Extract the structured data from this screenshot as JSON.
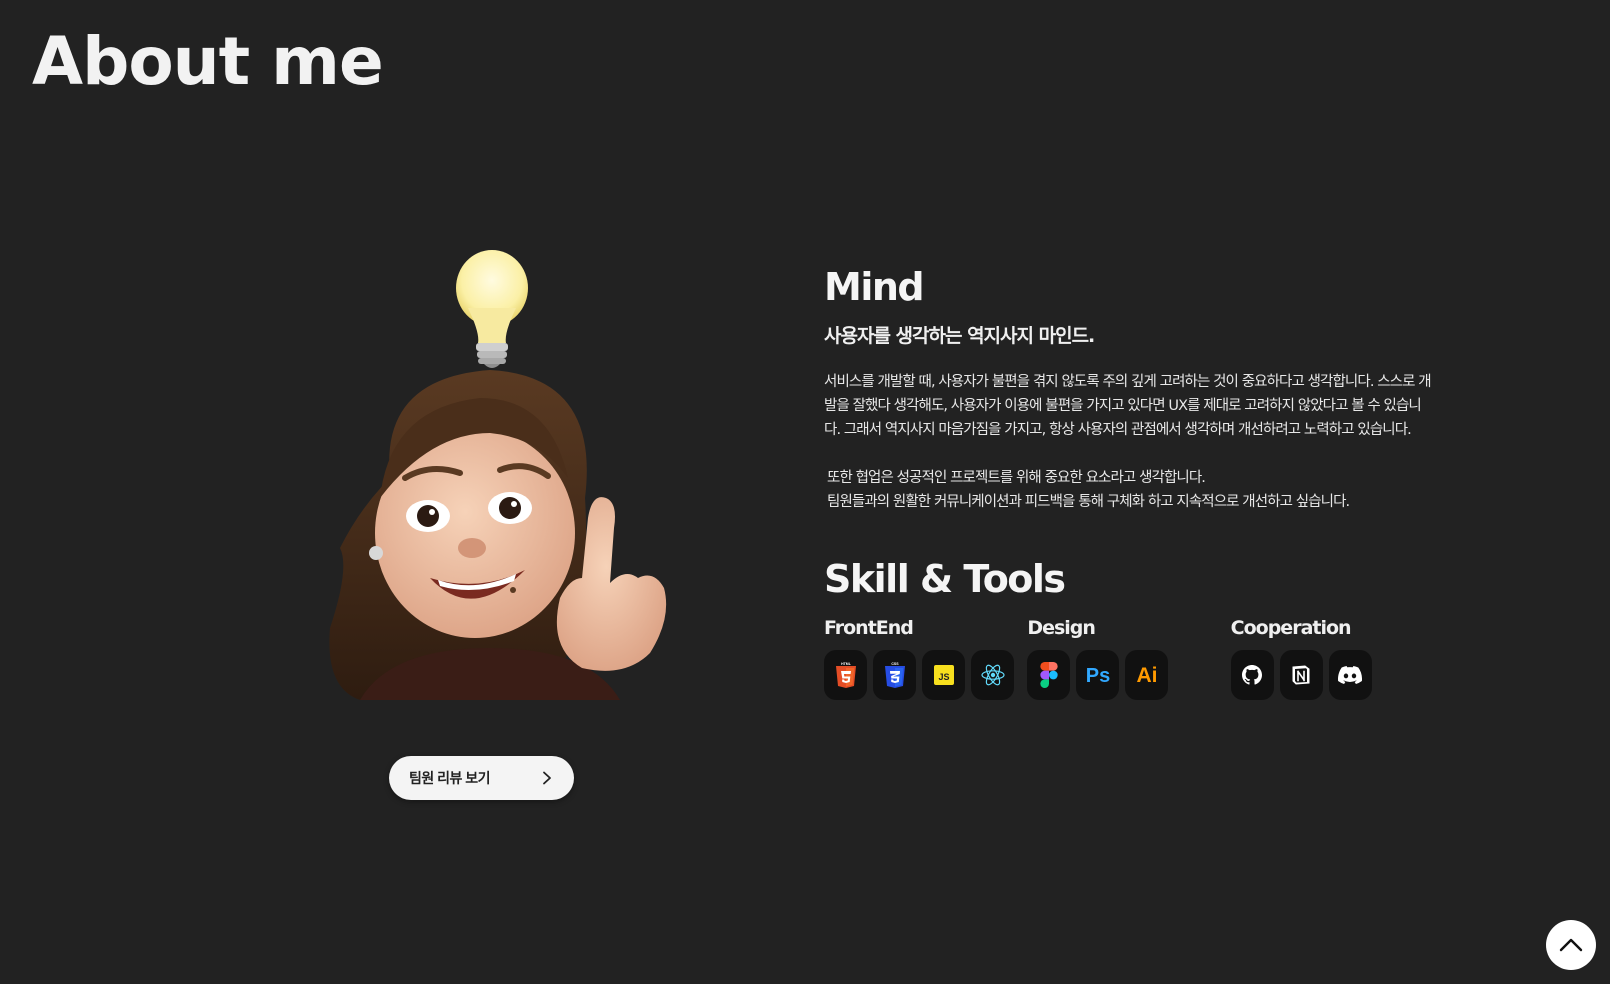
{
  "page": {
    "title": "About me"
  },
  "avatar": {
    "icons": [
      "lightbulb-icon",
      "memoji-avatar"
    ]
  },
  "review_button": {
    "label": "팀원 리뷰 보기",
    "icon": "chevron-right-icon"
  },
  "mind": {
    "title": "Mind",
    "headline": "사용자를 생각하는 역지사지 마인드.",
    "paragraph1": "서비스를 개발할 때, 사용자가 불편을 겪지 않도록 주의 깊게 고려하는 것이 중요하다고 생각합니다. 스스로 개발을 잘했다 생각해도, 사용자가 이용에 불편을 가지고 있다면 UX를 제대로 고려하지 않았다고 볼 수 있습니다. 그래서 역지사지 마음가짐을 가지고, 항상 사용자의 관점에서 생각하며 개선하려고 노력하고 있습니다.",
    "paragraph2_line1": "또한 협업은 성공적인 프로젝트를 위해 중요한 요소라고 생각합니다.",
    "paragraph2_line2": "팀원들과의 원활한 커뮤니케이션과 피드백을 통해 구체화 하고 지속적으로 개선하고 싶습니다."
  },
  "skills": {
    "title": "Skill & Tools",
    "groups": [
      {
        "title": "FrontEnd",
        "tools": [
          {
            "icon": "html5-icon",
            "label": "HTML",
            "color": "#E44D26"
          },
          {
            "icon": "css3-icon",
            "label": "CSS",
            "color": "#264DE4"
          },
          {
            "icon": "javascript-icon",
            "label": "JS",
            "color": "#F7DF1E"
          },
          {
            "icon": "react-icon",
            "color": "#61DAFB"
          }
        ]
      },
      {
        "title": "Design",
        "tools": [
          {
            "icon": "figma-icon"
          },
          {
            "icon": "photoshop-icon",
            "label": "Ps",
            "color": "#31A8FF"
          },
          {
            "icon": "illustrator-icon",
            "label": "Ai",
            "color": "#FF9A00"
          }
        ]
      },
      {
        "title": "Cooperation",
        "tools": [
          {
            "icon": "github-icon"
          },
          {
            "icon": "notion-icon"
          },
          {
            "icon": "discord-icon"
          }
        ]
      }
    ]
  },
  "scroll_top": {
    "icon": "chevron-up-icon"
  },
  "colors": {
    "background": "#222222",
    "tile": "#111111",
    "button": "#f4f4f4"
  }
}
